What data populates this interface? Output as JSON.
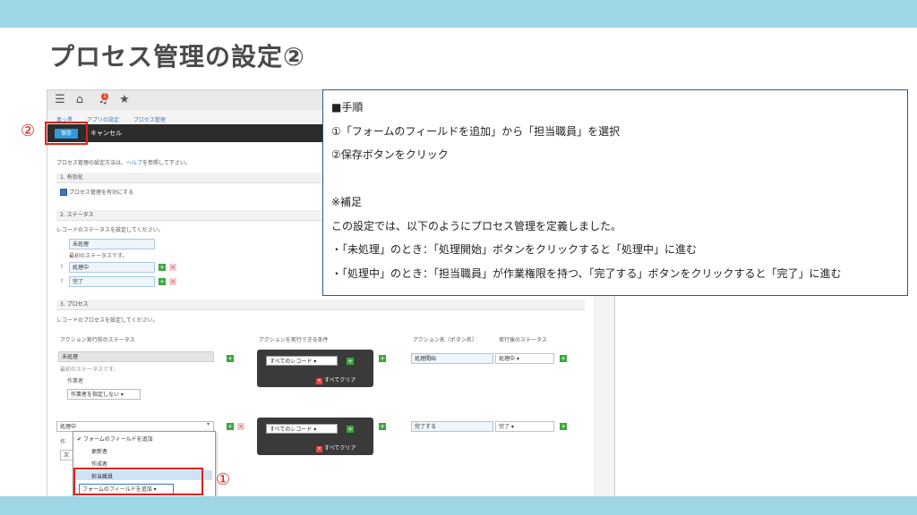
{
  "slide": {
    "title": "プロセス管理の設定②"
  },
  "app": {
    "breadcrumbs": [
      "",
      "真っ黒",
      "アプリの設定",
      "プロセス管理"
    ],
    "notification_count": "1",
    "save_label": "保存",
    "cancel_label": "キャンセル",
    "intro": "プロセス管理の設定方法は、",
    "help_link": "ヘルプ",
    "intro_tail": "を参照して下さい。",
    "sec1": "1. 有効化",
    "enable_label": "プロセス管理を有効にする",
    "sec2": "2. ステータス",
    "status_desc": "レコードのステータスを設定してください。",
    "statuses": [
      "未処理",
      "処理中",
      "完了"
    ],
    "initial_status_note": "最初のステータスです。",
    "sec3": "3. プロセス",
    "process_desc": "レコードのプロセスを設定してください。",
    "columns": [
      "アクション実行前のステータス",
      "アクションを実行できる条件",
      "アクション名（ボタン名）",
      "実行後のステータス"
    ],
    "row1": {
      "status": "未処理",
      "note": "最初のステータスです。",
      "assignee_label": "作業者",
      "assignee_select": "作業者を指定しない",
      "condition": "すべてのレコード",
      "clear": "すべてクリア",
      "action": "処理開始",
      "next": "処理中"
    },
    "row2": {
      "status": "処理中",
      "condition": "すべてのレコード",
      "clear": "すべてクリア",
      "action": "完了する",
      "next": "完了",
      "partial_label": "作",
      "partial_field": "次"
    },
    "dropdown_items": [
      "フォームのフィールドを追加",
      "更新者",
      "作成者",
      "担当職員"
    ],
    "selected_add_field": "フォームのフィールドを追加"
  },
  "markers": {
    "one": "①",
    "two": "②"
  },
  "note": {
    "lines": [
      "■手順",
      "①「フォームのフィールドを追加」から「担当職員」を選択",
      "②保存ボタンをクリック",
      "",
      "※補足",
      "この設定では、以下のようにプロセス管理を定義しました。",
      "・「未処理」のとき：「処理開始」ボタンをクリックすると「処理中」に進む",
      "・「処理中」のとき：「担当職員」が作業権限を持つ、「完了する」ボタンをクリックすると「完了」に進む"
    ]
  },
  "colors": {
    "accent_bar": "#9fd6e6",
    "highlight_red": "#e0211a",
    "note_border": "#2f5597"
  }
}
